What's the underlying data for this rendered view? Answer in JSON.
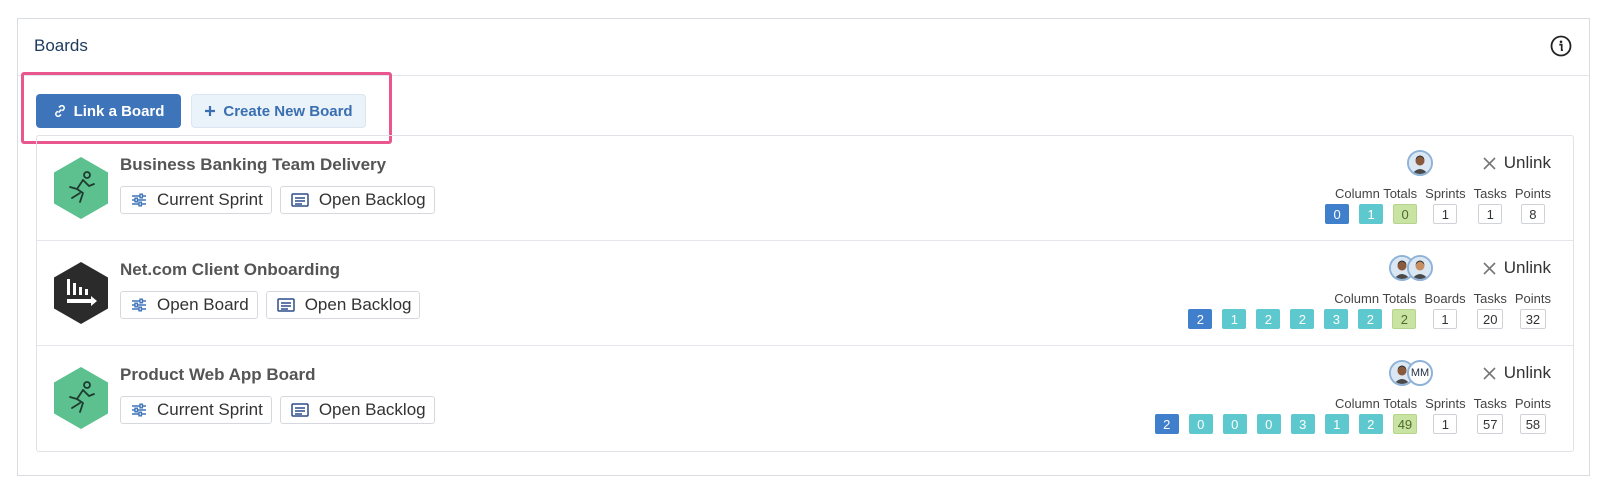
{
  "panel": {
    "title": "Boards"
  },
  "toolbar": {
    "link_label": "Link a Board",
    "create_label": "Create New Board"
  },
  "labels": {
    "column_totals": "Column Totals",
    "tasks": "Tasks",
    "points": "Points",
    "unlink": "Unlink"
  },
  "boards": [
    {
      "name": "Business Banking Team Delivery",
      "logo": "runner-icon",
      "links": [
        {
          "label": "Current Sprint",
          "icon": "sliders-icon"
        },
        {
          "label": "Open Backlog",
          "icon": "list-icon"
        }
      ],
      "avatars": [
        "avatar-photo"
      ],
      "column_totals": [
        "0",
        "1",
        "0"
      ],
      "column_colors": [
        "blue",
        "teal",
        "green"
      ],
      "count_label": "Sprints",
      "count_value": "1",
      "tasks": "1",
      "points": "8"
    },
    {
      "name": "Net.com Client Onboarding",
      "logo": "chart-arrow-icon",
      "links": [
        {
          "label": "Open Board",
          "icon": "sliders-icon"
        },
        {
          "label": "Open Backlog",
          "icon": "list-icon"
        }
      ],
      "avatars": [
        "avatar-photo",
        "avatar-photo"
      ],
      "column_totals": [
        "2",
        "1",
        "2",
        "2",
        "3",
        "2",
        "2"
      ],
      "column_colors": [
        "blue",
        "teal",
        "teal",
        "teal",
        "teal",
        "teal",
        "green"
      ],
      "count_label": "Boards",
      "count_value": "1",
      "tasks": "20",
      "points": "32"
    },
    {
      "name": "Product Web App Board",
      "logo": "runner-icon",
      "links": [
        {
          "label": "Current Sprint",
          "icon": "sliders-icon"
        },
        {
          "label": "Open Backlog",
          "icon": "list-icon"
        }
      ],
      "avatars": [
        "avatar-photo",
        "MM"
      ],
      "column_totals": [
        "2",
        "0",
        "0",
        "0",
        "3",
        "1",
        "2",
        "49"
      ],
      "column_colors": [
        "blue",
        "teal",
        "teal",
        "teal",
        "teal",
        "teal",
        "teal",
        "green"
      ],
      "count_label": "Sprints",
      "count_value": "1",
      "tasks": "57",
      "points": "58"
    }
  ],
  "colors": {
    "primary": "#3e74b9",
    "highlight": "#e9578e",
    "runner_logo": "#5cc08f",
    "dark_logo": "#2b2b2b"
  }
}
